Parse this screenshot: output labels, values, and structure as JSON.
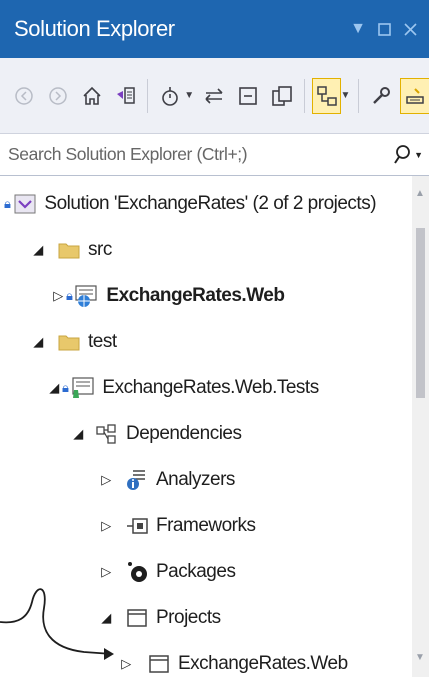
{
  "window": {
    "title": "Solution Explorer"
  },
  "search": {
    "placeholder": "Search Solution Explorer (Ctrl+;)"
  },
  "tree": {
    "solution": "Solution 'ExchangeRates' (2 of 2 projects)",
    "src": "src",
    "web_project": "ExchangeRates.Web",
    "test": "test",
    "tests_project": "ExchangeRates.Web.Tests",
    "dependencies": "Dependencies",
    "analyzers": "Analyzers",
    "frameworks": "Frameworks",
    "packages": "Packages",
    "projects": "Projects",
    "project_ref": "ExchangeRates.Web"
  },
  "colors": {
    "title_bar": "#1e66b0",
    "toolbar": "#eef0f6",
    "folder": "#e8c86b",
    "active_button": "#fff0b3"
  }
}
